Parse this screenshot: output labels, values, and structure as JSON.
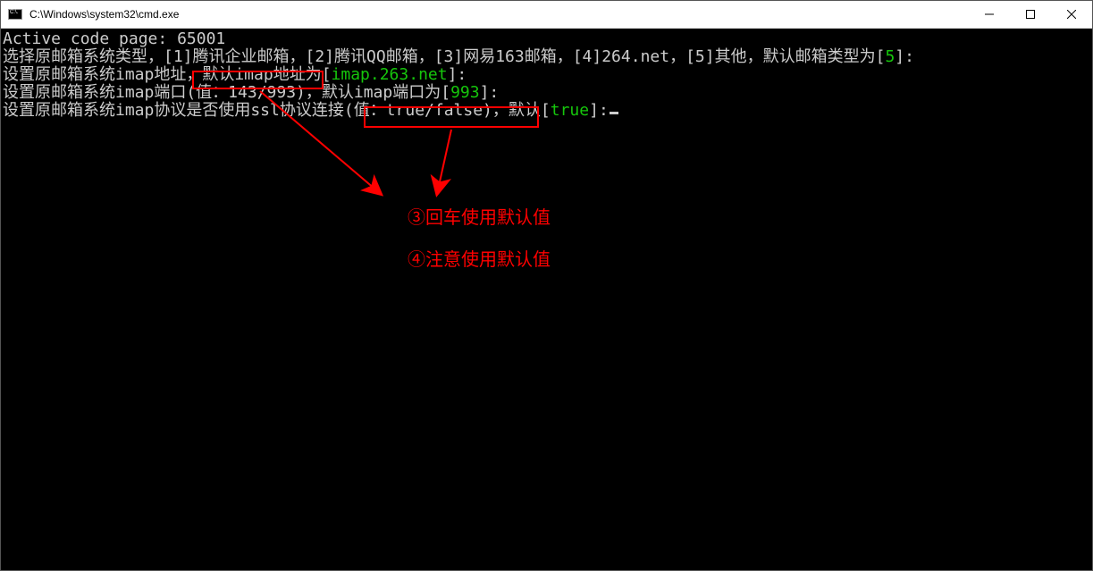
{
  "window": {
    "title": "C:\\Windows\\system32\\cmd.exe",
    "icon_text": "C:\\."
  },
  "terminal": {
    "line1": "Active code page: 65001",
    "line2": {
      "prefix": "选择原邮箱系统类型，[1]腾讯企业邮箱，[2]腾讯QQ邮箱，[3]网易163邮箱，[4]264.net，[5]其他，默认邮箱类型为[",
      "value": "5",
      "suffix": "]:"
    },
    "line3": {
      "prefix": "设置原邮箱系统imap地址，默认imap地址为[",
      "value": "imap.263.net",
      "suffix": "]:"
    },
    "line4": {
      "prefix": "设置原邮箱系统imap端口(值：143/993)，默认imap端口为[",
      "value": "993",
      "suffix": "]:"
    },
    "line5": {
      "prefix": "设置原邮箱系统imap协议是否使用ssl协议连接(值：true/false)，默认[",
      "value": "true",
      "suffix": "]:"
    }
  },
  "annotations": {
    "note1": "③回车使用默认值",
    "note2": "④注意使用默认值"
  },
  "colors": {
    "terminal_fg": "#cccccc",
    "terminal_green": "#16c60c",
    "annotation_red": "#ff0000",
    "background": "#000000"
  }
}
